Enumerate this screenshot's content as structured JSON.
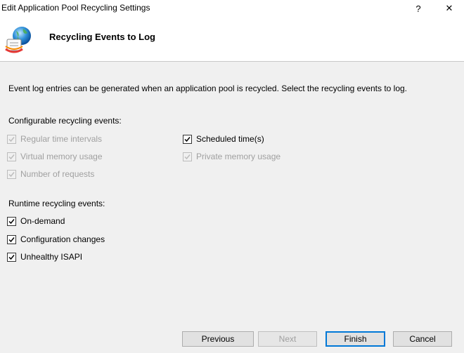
{
  "window": {
    "title": "Edit Application Pool Recycling Settings",
    "help_glyph": "?",
    "close_glyph": "✕"
  },
  "header": {
    "title": "Recycling Events to Log",
    "icon": "globe-recycle-icon"
  },
  "intro_text": "Event log entries can be generated when an application pool is recycled. Select the recycling events to log.",
  "configurable": {
    "label": "Configurable recycling events:",
    "items": [
      {
        "label": "Regular time intervals",
        "checked": true,
        "enabled": false
      },
      {
        "label": "Virtual memory usage",
        "checked": true,
        "enabled": false
      },
      {
        "label": "Number of requests",
        "checked": true,
        "enabled": false
      },
      {
        "label": "Scheduled time(s)",
        "checked": true,
        "enabled": true
      },
      {
        "label": "Private memory usage",
        "checked": true,
        "enabled": false
      }
    ]
  },
  "runtime": {
    "label": "Runtime recycling events:",
    "items": [
      {
        "label": "On-demand",
        "checked": true,
        "enabled": true
      },
      {
        "label": "Configuration changes",
        "checked": true,
        "enabled": true
      },
      {
        "label": "Unhealthy ISAPI",
        "checked": true,
        "enabled": true
      }
    ]
  },
  "buttons": {
    "previous": "Previous",
    "next": "Next",
    "finish": "Finish",
    "cancel": "Cancel"
  },
  "colors": {
    "accent": "#0078d7",
    "disabled_text": "#a0a0a0"
  }
}
